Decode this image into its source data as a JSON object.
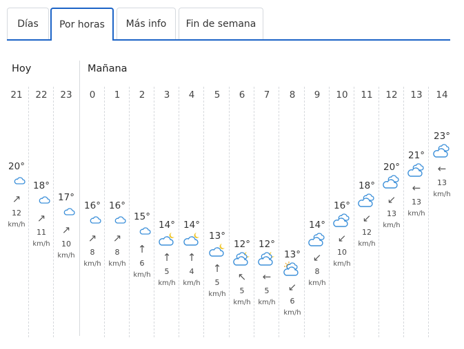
{
  "tabs": [
    {
      "label": "Días",
      "active": false
    },
    {
      "label": "Por horas",
      "active": true
    },
    {
      "label": "Más info",
      "active": false
    },
    {
      "label": "Fin de semana",
      "active": false
    }
  ],
  "days": {
    "today": "Hoy",
    "tomorrow": "Mañana"
  },
  "wind_unit": "km/h",
  "colors": {
    "accent": "#1b63c6",
    "moon": "#f0c62b",
    "cloud_stroke": "#3b8fd9",
    "sun": "#f0a31b"
  },
  "hours": [
    {
      "hour": "21",
      "temp": "20°",
      "icon": "moon-cloud-icon",
      "wind_arrow": "↗",
      "wind_speed": "12"
    },
    {
      "hour": "22",
      "temp": "18°",
      "icon": "moon-cloud-icon",
      "wind_arrow": "↗",
      "wind_speed": "11"
    },
    {
      "hour": "23",
      "temp": "17°",
      "icon": "moon-cloud-icon",
      "wind_arrow": "↗",
      "wind_speed": "10"
    },
    {
      "hour": "0",
      "temp": "16°",
      "icon": "moon-cloud-icon",
      "wind_arrow": "↗",
      "wind_speed": "8"
    },
    {
      "hour": "1",
      "temp": "16°",
      "icon": "moon-cloud-icon",
      "wind_arrow": "↗",
      "wind_speed": "8"
    },
    {
      "hour": "2",
      "temp": "15°",
      "icon": "moon-cloud-icon",
      "wind_arrow": "↑",
      "wind_speed": "6"
    },
    {
      "hour": "3",
      "temp": "14°",
      "icon": "cloud-moon-icon",
      "wind_arrow": "↑",
      "wind_speed": "5"
    },
    {
      "hour": "4",
      "temp": "14°",
      "icon": "cloud-moon-icon",
      "wind_arrow": "↑",
      "wind_speed": "4"
    },
    {
      "hour": "5",
      "temp": "13°",
      "icon": "cloud-moon-icon",
      "wind_arrow": "↑",
      "wind_speed": "5"
    },
    {
      "hour": "6",
      "temp": "12°",
      "icon": "clouds-moon-icon",
      "wind_arrow": "↖",
      "wind_speed": "5"
    },
    {
      "hour": "7",
      "temp": "12°",
      "icon": "clouds-moon-icon",
      "wind_arrow": "←",
      "wind_speed": "5"
    },
    {
      "hour": "8",
      "temp": "13°",
      "icon": "sun-clouds-icon",
      "wind_arrow": "↙",
      "wind_speed": "6"
    },
    {
      "hour": "9",
      "temp": "14°",
      "icon": "clouds-icon",
      "wind_arrow": "↙",
      "wind_speed": "8"
    },
    {
      "hour": "10",
      "temp": "16°",
      "icon": "clouds-icon",
      "wind_arrow": "↙",
      "wind_speed": "10"
    },
    {
      "hour": "11",
      "temp": "18°",
      "icon": "clouds-icon",
      "wind_arrow": "↙",
      "wind_speed": "12"
    },
    {
      "hour": "12",
      "temp": "20°",
      "icon": "clouds-icon",
      "wind_arrow": "↙",
      "wind_speed": "13"
    },
    {
      "hour": "13",
      "temp": "21°",
      "icon": "clouds-icon",
      "wind_arrow": "←",
      "wind_speed": "13"
    },
    {
      "hour": "14",
      "temp": "23°",
      "icon": "clouds-icon",
      "wind_arrow": "←",
      "wind_speed": "13"
    }
  ]
}
